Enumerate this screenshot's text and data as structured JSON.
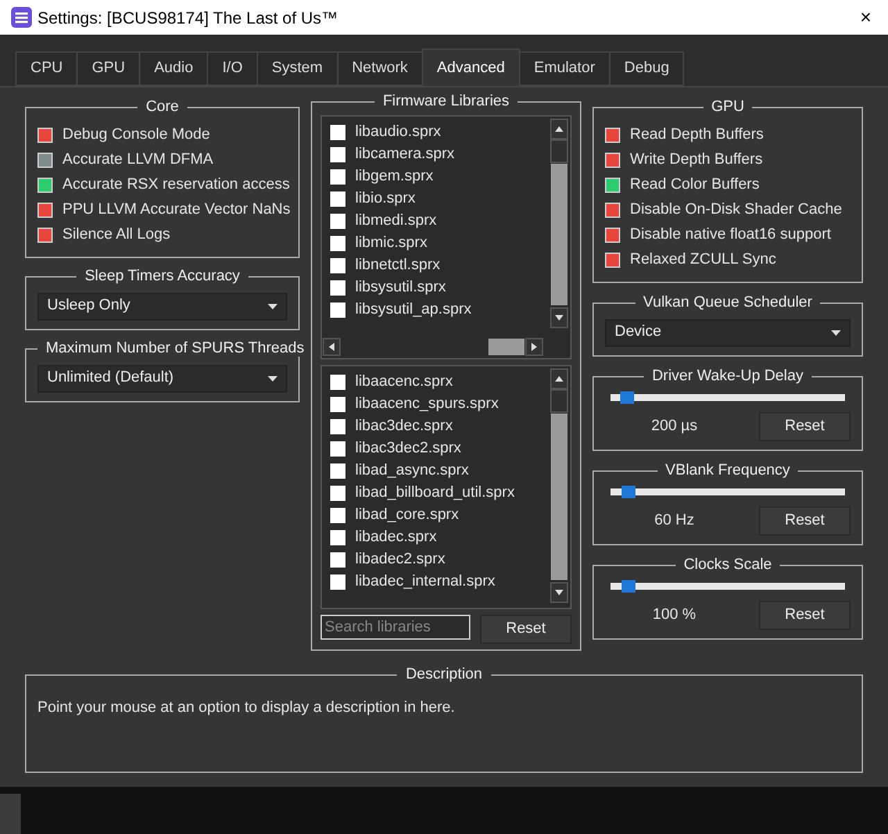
{
  "window": {
    "title": "Settings: [BCUS98174] The Last of Us™",
    "close": "×"
  },
  "tabs": [
    {
      "label": "CPU",
      "selected": false
    },
    {
      "label": "GPU",
      "selected": false
    },
    {
      "label": "Audio",
      "selected": false
    },
    {
      "label": "I/O",
      "selected": false
    },
    {
      "label": "System",
      "selected": false
    },
    {
      "label": "Network",
      "selected": false
    },
    {
      "label": "Advanced",
      "selected": true
    },
    {
      "label": "Emulator",
      "selected": false
    },
    {
      "label": "Debug",
      "selected": false
    }
  ],
  "core": {
    "title": "Core",
    "options": [
      {
        "label": "Debug Console Mode",
        "color": "#e8453c"
      },
      {
        "label": "Accurate LLVM DFMA",
        "color": "#7f8c8d"
      },
      {
        "label": "Accurate RSX reservation access",
        "color": "#2ecc71"
      },
      {
        "label": "PPU LLVM Accurate Vector NaNs",
        "color": "#e8453c"
      },
      {
        "label": "Silence All Logs",
        "color": "#e8453c"
      }
    ]
  },
  "sleep_timers": {
    "title": "Sleep Timers Accuracy",
    "value": "Usleep Only"
  },
  "spurs_threads": {
    "title": "Maximum Number of SPURS Threads",
    "value": "Unlimited (Default)"
  },
  "firmware": {
    "title": "Firmware Libraries",
    "list_1": [
      {
        "label": "libaudio.sprx",
        "checked": false
      },
      {
        "label": "libcamera.sprx",
        "checked": false
      },
      {
        "label": "libgem.sprx",
        "checked": false
      },
      {
        "label": "libio.sprx",
        "checked": false
      },
      {
        "label": "libmedi.sprx",
        "checked": false
      },
      {
        "label": "libmic.sprx",
        "checked": false
      },
      {
        "label": "libnetctl.sprx",
        "checked": false
      },
      {
        "label": "libsysutil.sprx",
        "checked": false
      },
      {
        "label": "libsysutil_ap.sprx",
        "checked": false
      }
    ],
    "list_2": [
      {
        "label": "libaacenc.sprx",
        "checked": false
      },
      {
        "label": "libaacenc_spurs.sprx",
        "checked": false
      },
      {
        "label": "libac3dec.sprx",
        "checked": false
      },
      {
        "label": "libac3dec2.sprx",
        "checked": false
      },
      {
        "label": "libad_async.sprx",
        "checked": false
      },
      {
        "label": "libad_billboard_util.sprx",
        "checked": false
      },
      {
        "label": "libad_core.sprx",
        "checked": false
      },
      {
        "label": "libadec.sprx",
        "checked": false
      },
      {
        "label": "libadec2.sprx",
        "checked": false
      },
      {
        "label": "libadec_internal.sprx",
        "checked": false
      }
    ],
    "search": {
      "placeholder": "Search libraries"
    },
    "reset": "Reset"
  },
  "gpu": {
    "title": "GPU",
    "options": [
      {
        "label": "Read Depth Buffers",
        "color": "#e8453c"
      },
      {
        "label": "Write Depth Buffers",
        "color": "#e8453c"
      },
      {
        "label": "Read Color Buffers",
        "color": "#2ecc71"
      },
      {
        "label": "Disable On-Disk Shader Cache",
        "color": "#e8453c"
      },
      {
        "label": "Disable native float16 support",
        "color": "#e8453c"
      },
      {
        "label": "Relaxed ZCULL Sync",
        "color": "#e8453c"
      }
    ]
  },
  "vulkan_queue": {
    "title": "Vulkan Queue Scheduler",
    "value": "Device"
  },
  "sliders": [
    {
      "title": "Driver Wake-Up Delay",
      "level": 0.04,
      "reading": "200 µs",
      "reset": "Reset"
    },
    {
      "title": "VBlank Frequency",
      "level": 0.05,
      "reading": "60 Hz",
      "reset": "Reset"
    },
    {
      "title": "Clocks Scale",
      "level": 0.05,
      "reading": "100 %",
      "reset": "Reset"
    }
  ],
  "description": {
    "title": "Description",
    "text": "Point your mouse at an option to display a description in here."
  }
}
